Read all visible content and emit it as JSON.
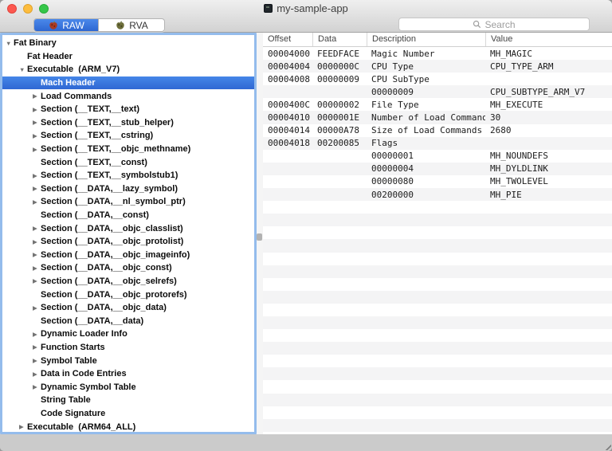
{
  "window": {
    "title": "my-sample-app"
  },
  "toolbar": {
    "segments": [
      {
        "label": "RAW",
        "selected": true,
        "icon": "red-apple"
      },
      {
        "label": "RVA",
        "selected": false,
        "icon": "olive-apple"
      }
    ],
    "search": {
      "placeholder": "Search"
    }
  },
  "colors": {
    "selection_blue": "#3b77dc",
    "segment_selected_blue": "#3a78e0",
    "focus_ring": "#94bcec",
    "row_stripe": "#f4f4f5",
    "traffic_red": "#fc5850",
    "traffic_yellow": "#fdbd3e",
    "traffic_green": "#35c649"
  },
  "sidebar": {
    "items": [
      {
        "label": "Fat Binary",
        "level": 0,
        "arrow": "expanded",
        "selected": false
      },
      {
        "label": "Fat Header",
        "level": 1,
        "arrow": "none",
        "selected": false
      },
      {
        "label": "Executable  (ARM_V7)",
        "level": 1,
        "arrow": "expanded",
        "selected": false
      },
      {
        "label": "Mach Header",
        "level": 2,
        "arrow": "none",
        "selected": true
      },
      {
        "label": "Load Commands",
        "level": 2,
        "arrow": "collapsed",
        "selected": false
      },
      {
        "label": "Section (__TEXT,__text)",
        "level": 2,
        "arrow": "collapsed",
        "selected": false
      },
      {
        "label": "Section (__TEXT,__stub_helper)",
        "level": 2,
        "arrow": "collapsed",
        "selected": false
      },
      {
        "label": "Section (__TEXT,__cstring)",
        "level": 2,
        "arrow": "collapsed",
        "selected": false
      },
      {
        "label": "Section (__TEXT,__objc_methname)",
        "level": 2,
        "arrow": "collapsed",
        "selected": false
      },
      {
        "label": "Section (__TEXT,__const)",
        "level": 2,
        "arrow": "none",
        "selected": false
      },
      {
        "label": "Section (__TEXT,__symbolstub1)",
        "level": 2,
        "arrow": "collapsed",
        "selected": false
      },
      {
        "label": "Section (__DATA,__lazy_symbol)",
        "level": 2,
        "arrow": "collapsed",
        "selected": false
      },
      {
        "label": "Section (__DATA,__nl_symbol_ptr)",
        "level": 2,
        "arrow": "collapsed",
        "selected": false
      },
      {
        "label": "Section (__DATA,__const)",
        "level": 2,
        "arrow": "none",
        "selected": false
      },
      {
        "label": "Section (__DATA,__objc_classlist)",
        "level": 2,
        "arrow": "collapsed",
        "selected": false
      },
      {
        "label": "Section (__DATA,__objc_protolist)",
        "level": 2,
        "arrow": "collapsed",
        "selected": false
      },
      {
        "label": "Section (__DATA,__objc_imageinfo)",
        "level": 2,
        "arrow": "collapsed",
        "selected": false
      },
      {
        "label": "Section (__DATA,__objc_const)",
        "level": 2,
        "arrow": "collapsed",
        "selected": false
      },
      {
        "label": "Section (__DATA,__objc_selrefs)",
        "level": 2,
        "arrow": "collapsed",
        "selected": false
      },
      {
        "label": "Section (__DATA,__objc_protorefs)",
        "level": 2,
        "arrow": "none",
        "selected": false
      },
      {
        "label": "Section (__DATA,__objc_data)",
        "level": 2,
        "arrow": "collapsed",
        "selected": false
      },
      {
        "label": "Section (__DATA,__data)",
        "level": 2,
        "arrow": "none",
        "selected": false
      },
      {
        "label": "Dynamic Loader Info",
        "level": 2,
        "arrow": "collapsed",
        "selected": false
      },
      {
        "label": "Function Starts",
        "level": 2,
        "arrow": "collapsed",
        "selected": false
      },
      {
        "label": "Symbol Table",
        "level": 2,
        "arrow": "collapsed",
        "selected": false
      },
      {
        "label": "Data in Code Entries",
        "level": 2,
        "arrow": "collapsed",
        "selected": false
      },
      {
        "label": "Dynamic Symbol Table",
        "level": 2,
        "arrow": "collapsed",
        "selected": false
      },
      {
        "label": "String Table",
        "level": 2,
        "arrow": "none",
        "selected": false
      },
      {
        "label": "Code Signature",
        "level": 2,
        "arrow": "none",
        "selected": false
      },
      {
        "label": "Executable  (ARM64_ALL)",
        "level": 1,
        "arrow": "collapsed",
        "selected": false
      }
    ]
  },
  "table": {
    "columns": [
      "Offset",
      "Data",
      "Description",
      "Value"
    ],
    "rows": [
      {
        "offset": "00004000",
        "data": "FEEDFACE",
        "description": "Magic Number",
        "value": "MH_MAGIC"
      },
      {
        "offset": "00004004",
        "data": "0000000C",
        "description": "CPU Type",
        "value": "CPU_TYPE_ARM"
      },
      {
        "offset": "00004008",
        "data": "00000009",
        "description": "CPU SubType",
        "value": ""
      },
      {
        "offset": "",
        "data": "",
        "description": "00000009",
        "value": "CPU_SUBTYPE_ARM_V7"
      },
      {
        "offset": "0000400C",
        "data": "00000002",
        "description": "File Type",
        "value": "MH_EXECUTE"
      },
      {
        "offset": "00004010",
        "data": "0000001E",
        "description": "Number of Load Commands",
        "value": "30"
      },
      {
        "offset": "00004014",
        "data": "00000A78",
        "description": "Size of Load Commands",
        "value": "2680"
      },
      {
        "offset": "00004018",
        "data": "00200085",
        "description": "Flags",
        "value": ""
      },
      {
        "offset": "",
        "data": "",
        "description": "00000001",
        "value": "MH_NOUNDEFS"
      },
      {
        "offset": "",
        "data": "",
        "description": "00000004",
        "value": "MH_DYLDLINK"
      },
      {
        "offset": "",
        "data": "",
        "description": "00000080",
        "value": "MH_TWOLEVEL"
      },
      {
        "offset": "",
        "data": "",
        "description": "00200000",
        "value": "MH_PIE"
      }
    ]
  }
}
